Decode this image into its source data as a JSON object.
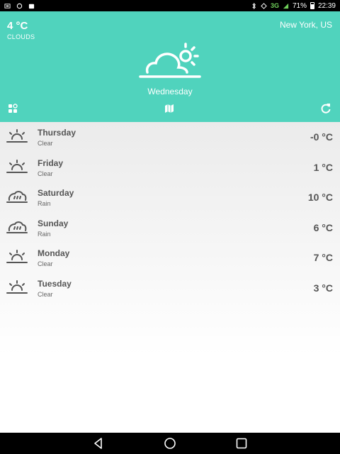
{
  "status_bar": {
    "network": "3G",
    "battery": "71%",
    "time": "22:39"
  },
  "header": {
    "temperature": "4 °C",
    "condition": "CLOUDS",
    "location": "New York, US",
    "day": "Wednesday",
    "hero_icon": "cloud-sun-icon",
    "accent_color": "#50d3bd"
  },
  "toolbar": {
    "left_icon": "grid-icon",
    "middle_icon": "map-icon",
    "right_icon": "refresh-icon"
  },
  "forecast": [
    {
      "day": "Thursday",
      "desc": "Clear",
      "temp": "-0 °C",
      "icon": "sunrise-icon"
    },
    {
      "day": "Friday",
      "desc": "Clear",
      "temp": "1 °C",
      "icon": "sunrise-icon"
    },
    {
      "day": "Saturday",
      "desc": "Rain",
      "temp": "10 °C",
      "icon": "rain-icon"
    },
    {
      "day": "Sunday",
      "desc": "Rain",
      "temp": "6 °C",
      "icon": "rain-icon"
    },
    {
      "day": "Monday",
      "desc": "Clear",
      "temp": "7 °C",
      "icon": "sunrise-icon"
    },
    {
      "day": "Tuesday",
      "desc": "Clear",
      "temp": "3 °C",
      "icon": "sunrise-icon"
    }
  ],
  "nav": {
    "back_icon": "back-icon",
    "home_icon": "home-icon",
    "recents_icon": "recents-icon"
  }
}
